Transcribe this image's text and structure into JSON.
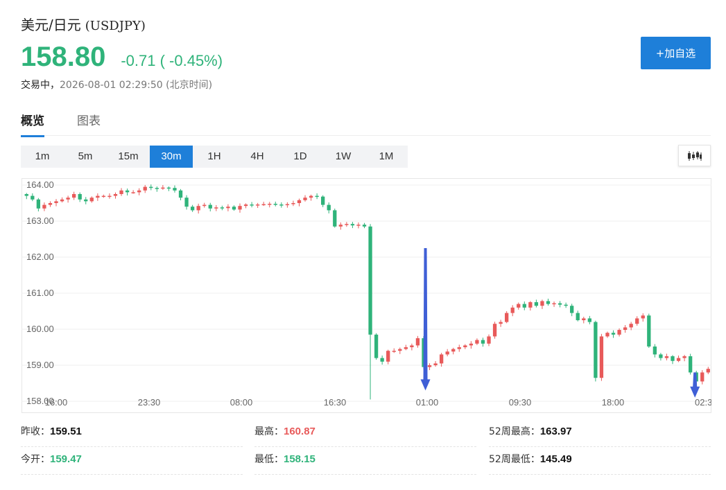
{
  "header": {
    "name": "美元/日元",
    "code": "(USDJPY)",
    "price": "158.80",
    "change": "-0.71 ( -0.45%)",
    "status": "交易中，",
    "timestamp": "2026-08-01 02:29:50 (北京时间)",
    "add_button": "+加自选"
  },
  "tabs": [
    {
      "label": "概览",
      "active": true
    },
    {
      "label": "图表",
      "active": false
    }
  ],
  "periods": [
    {
      "label": "1m",
      "active": false
    },
    {
      "label": "5m",
      "active": false
    },
    {
      "label": "15m",
      "active": false
    },
    {
      "label": "30m",
      "active": true
    },
    {
      "label": "1H",
      "active": false
    },
    {
      "label": "4H",
      "active": false
    },
    {
      "label": "1D",
      "active": false
    },
    {
      "label": "1W",
      "active": false
    },
    {
      "label": "1M",
      "active": false
    }
  ],
  "chart_type_icon": "candlestick-icon",
  "colors": {
    "up": "#e85a5a",
    "down": "#2fb37a",
    "accent": "#1e7fd9",
    "arrow": "#3f5fd6"
  },
  "chart_data": {
    "type": "candlestick",
    "y_ticks": [
      "164.00",
      "163.00",
      "162.00",
      "161.00",
      "160.00",
      "159.00",
      "158.00"
    ],
    "x_ticks": [
      "16:00",
      "23:30",
      "08:00",
      "16:30",
      "01:00",
      "09:30",
      "18:00",
      "02:3"
    ],
    "ylim": [
      158.0,
      164.2
    ],
    "grid": true,
    "closes": [
      163.7,
      163.6,
      163.35,
      163.45,
      163.5,
      163.55,
      163.6,
      163.65,
      163.75,
      163.6,
      163.55,
      163.65,
      163.7,
      163.7,
      163.7,
      163.75,
      163.85,
      163.8,
      163.8,
      163.85,
      163.95,
      163.92,
      163.9,
      163.93,
      163.92,
      163.85,
      163.65,
      163.4,
      163.3,
      163.42,
      163.45,
      163.35,
      163.38,
      163.36,
      163.4,
      163.32,
      163.42,
      163.46,
      163.45,
      163.46,
      163.47,
      163.48,
      163.46,
      163.45,
      163.47,
      163.5,
      163.58,
      163.65,
      163.7,
      163.68,
      163.45,
      163.3,
      162.85,
      162.9,
      162.92,
      162.88,
      162.9,
      162.85,
      159.85,
      159.2,
      159.1,
      159.4,
      159.4,
      159.45,
      159.5,
      159.55,
      159.75,
      158.95,
      159.0,
      159.05,
      159.3,
      159.38,
      159.45,
      159.5,
      159.55,
      159.6,
      159.7,
      159.6,
      159.8,
      160.15,
      160.2,
      160.45,
      160.6,
      160.7,
      160.6,
      160.75,
      160.65,
      160.78,
      160.7,
      160.72,
      160.68,
      160.65,
      160.45,
      160.25,
      160.3,
      160.2,
      158.65,
      159.8,
      159.9,
      159.85,
      159.98,
      160.05,
      160.15,
      160.3,
      160.38,
      159.52,
      159.3,
      159.2,
      159.25,
      159.12,
      159.2,
      159.25,
      158.8,
      158.55,
      158.8,
      158.9
    ],
    "arrows": [
      {
        "x_index": 68,
        "from": 162.25,
        "to": 158.3
      },
      {
        "x_index": 113,
        "from": 158.8,
        "to": 158.1
      }
    ]
  },
  "stats": {
    "prev_close_label": "昨收：",
    "prev_close": "159.51",
    "high_label": "最高：",
    "high": "160.87",
    "week52_high_label": "52周最高：",
    "week52_high": "163.97",
    "open_label": "今开：",
    "open": "159.47",
    "low_label": "最低：",
    "low": "158.15",
    "week52_low_label": "52周最低：",
    "week52_low": "145.49"
  }
}
